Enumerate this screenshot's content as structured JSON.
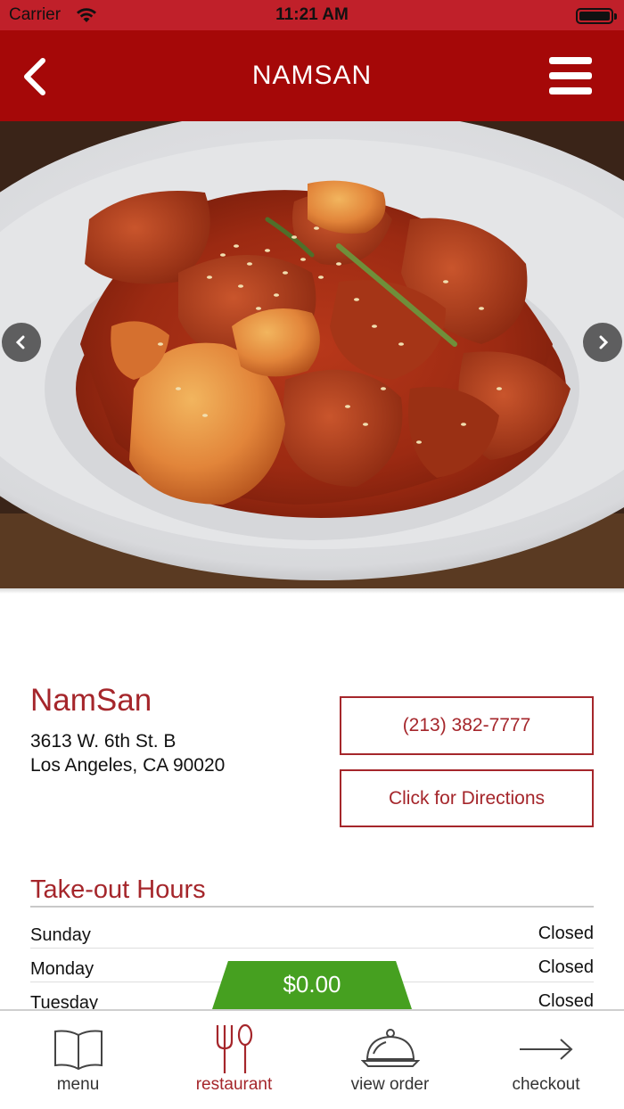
{
  "status_bar": {
    "carrier": "Carrier",
    "time": "11:21 AM"
  },
  "nav": {
    "title": "NAMSAN"
  },
  "hero": {
    "alt": "dish photo"
  },
  "restaurant": {
    "name": "NamSan",
    "address_line1": "3613 W. 6th St. B",
    "address_line2": "Los Angeles, CA 90020",
    "phone": "(213) 382-7777",
    "directions_label": "Click for Directions"
  },
  "hours": {
    "title": "Take-out Hours",
    "rows": [
      {
        "day": "Sunday",
        "status": "Closed"
      },
      {
        "day": "Monday",
        "status": "Closed"
      },
      {
        "day": "Tuesday",
        "status": "Closed"
      }
    ]
  },
  "order": {
    "total": "$0.00"
  },
  "tabs": [
    {
      "label": "menu",
      "icon": "book-icon"
    },
    {
      "label": "restaurant",
      "icon": "utensils-icon"
    },
    {
      "label": "view order",
      "icon": "cloche-icon"
    },
    {
      "label": "checkout",
      "icon": "arrow-right-icon"
    }
  ],
  "colors": {
    "brand_red": "#a50808",
    "status_red": "#c0202a",
    "accent_text": "#a5262b",
    "total_green": "#46a020"
  }
}
